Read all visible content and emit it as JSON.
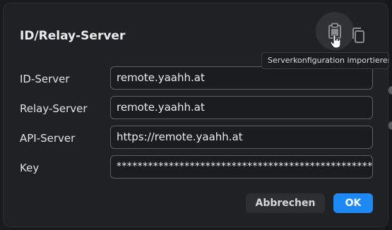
{
  "dialog": {
    "title": "ID/Relay-Server",
    "tooltip": "Serverkonfiguration importieren",
    "icons": {
      "paste": "clipboard-paste-icon",
      "copy": "copy-icon",
      "cursor": "hand-pointer-icon"
    },
    "fields": [
      {
        "label": "ID-Server",
        "value": "remote.yaahh.at"
      },
      {
        "label": "Relay-Server",
        "value": "remote.yaahh.at"
      },
      {
        "label": "API-Server",
        "value": "https://remote.yaahh.at"
      },
      {
        "label": "Key",
        "value": "*****************************************************"
      }
    ],
    "buttons": {
      "cancel": "Abbrechen",
      "ok": "OK"
    }
  },
  "colors": {
    "background": "#202124",
    "accent": "#1e88f5",
    "text": "#ececec"
  }
}
